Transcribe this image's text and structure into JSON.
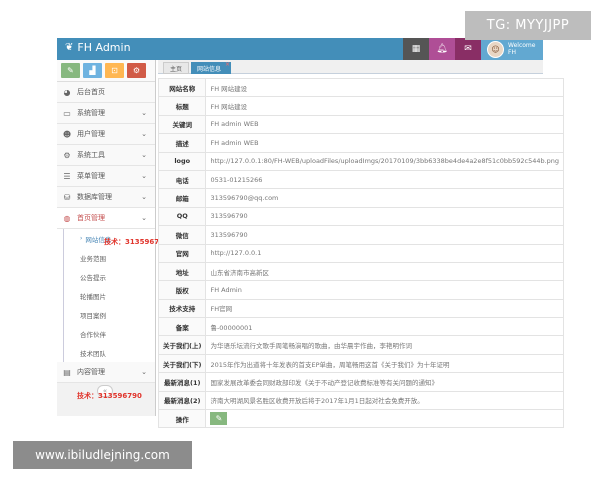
{
  "overlay": {
    "tg_badge": "TG: MYYJJPP",
    "site_badge": "www.ibiludlejning.com",
    "wm_top": "技术：313596790",
    "wm_bottom": "技术：313596790"
  },
  "header": {
    "app_title": "FH Admin",
    "welcome": "Welcome",
    "username": "FH",
    "buttons": [
      "tasks-icon",
      "bell-icon",
      "envelope-icon"
    ]
  },
  "sidebar": {
    "shortcut_icons": [
      "pencil-icon",
      "chart-icon",
      "users-icon",
      "cogs-icon"
    ],
    "items": [
      {
        "label": "后台首页",
        "icon": "dashboard-icon"
      },
      {
        "label": "系统管理",
        "icon": "desktop-icon"
      },
      {
        "label": "用户管理",
        "icon": "users-icon"
      },
      {
        "label": "系统工具",
        "icon": "cog-icon"
      },
      {
        "label": "菜单管理",
        "icon": "list-icon"
      },
      {
        "label": "数据库管理",
        "icon": "database-icon"
      },
      {
        "label": "首页管理",
        "icon": "globe-icon"
      }
    ],
    "submenu": [
      {
        "label": "网站信息",
        "active": true
      },
      {
        "label": "业务范围"
      },
      {
        "label": "公告提示"
      },
      {
        "label": "轮播图片"
      },
      {
        "label": "项目案例"
      },
      {
        "label": "合作伙伴"
      },
      {
        "label": "技术团队"
      }
    ],
    "bottom_item": {
      "label": "内容管理",
      "icon": "book-icon"
    }
  },
  "tabs": [
    {
      "label": "主页"
    },
    {
      "label": "网站信息"
    }
  ],
  "rows": [
    {
      "key": "网站名称",
      "value": "FH 网站建设"
    },
    {
      "key": "标题",
      "value": "FH 网站建设"
    },
    {
      "key": "关键词",
      "value": "FH admin WEB"
    },
    {
      "key": "描述",
      "value": "FH admin WEB"
    },
    {
      "key": "logo",
      "value": "http://127.0.0.1:80/FH-WEB/uploadFiles/uploadImgs/20170109/3bb6338be4de4a2e8f51c0bb592c544b.png"
    },
    {
      "key": "电话",
      "value": "0531-01215266"
    },
    {
      "key": "邮箱",
      "value": "313596790@qq.com"
    },
    {
      "key": "QQ",
      "value": "313596790"
    },
    {
      "key": "微信",
      "value": "313596790"
    },
    {
      "key": "官网",
      "value": "http://127.0.0.1"
    },
    {
      "key": "地址",
      "value": "山东省济南市高新区"
    },
    {
      "key": "版权",
      "value": "FH Admin"
    },
    {
      "key": "技术支持",
      "value": "FH官网"
    },
    {
      "key": "备案",
      "value": "鲁-00000001"
    },
    {
      "key": "关于我们(上)",
      "value": "为华语乐坛流行文歌手周笔畅演唱的歌曲，由华晨宇作曲，李艳明作词"
    },
    {
      "key": "关于我们(下)",
      "value": "2015年作为出道将十年发表的首支EP单曲，周笔畅用这首《关于我们》为十年证明"
    },
    {
      "key": "最新消息(1)",
      "value": "国家发展改革委会同财政部印发《关于不动产登记收费标准等有关问题的通知》"
    },
    {
      "key": "最新消息(2)",
      "value": "济南大明湖风景名胜区收费开放后将于2017年1月1日起对社会免费开放。"
    },
    {
      "key": "操作",
      "value": ""
    }
  ]
}
